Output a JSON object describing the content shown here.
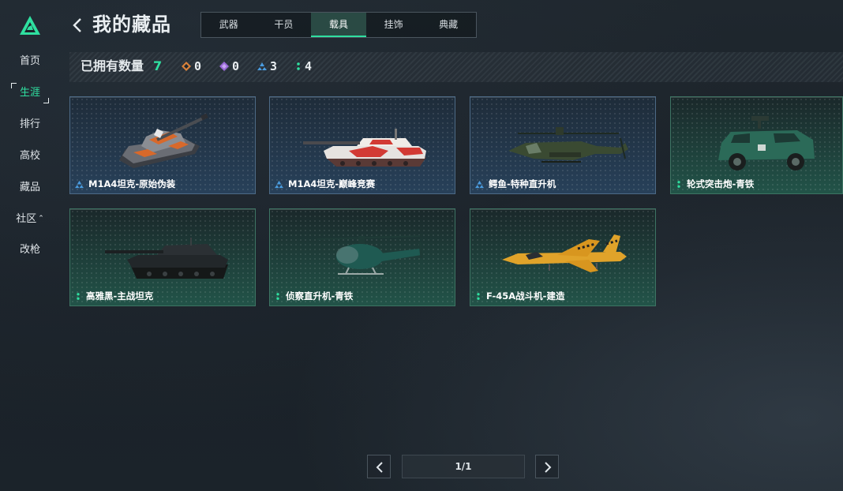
{
  "sidebar": {
    "items": [
      {
        "label": "首页",
        "active": false
      },
      {
        "label": "生涯",
        "active": true
      },
      {
        "label": "排行",
        "active": false
      },
      {
        "label": "高校",
        "active": false
      },
      {
        "label": "藏品",
        "active": false
      },
      {
        "label": "社区",
        "active": false,
        "has_chevron": true
      },
      {
        "label": "改枪",
        "active": false
      }
    ]
  },
  "header": {
    "title": "我的藏品",
    "tabs": [
      {
        "label": "武器",
        "active": false
      },
      {
        "label": "干员",
        "active": false
      },
      {
        "label": "载具",
        "active": true
      },
      {
        "label": "挂饰",
        "active": false
      },
      {
        "label": "典藏",
        "active": false
      }
    ]
  },
  "summary": {
    "owned_label": "已拥有数量",
    "owned_count": "7",
    "rarity_counts": [
      {
        "icon": "orange-diamond-rarity-icon",
        "color": "#d9823b",
        "count": "0"
      },
      {
        "icon": "purple-diamond-rarity-icon",
        "color": "#9b6ad8",
        "count": "0"
      },
      {
        "icon": "blue-triangle-rarity-icon",
        "color": "#4a9ce0",
        "count": "3"
      },
      {
        "icon": "green-dots-rarity-icon",
        "color": "#2fe0a0",
        "count": "4"
      }
    ]
  },
  "items": [
    {
      "name": "M1A4坦克-原始伪装",
      "rarity": "blue",
      "vehicle": "tank-orange-camo"
    },
    {
      "name": "M1A4坦克-巅峰竞赛",
      "rarity": "blue",
      "vehicle": "tank-red-white"
    },
    {
      "name": "鳄鱼-特种直升机",
      "rarity": "blue",
      "vehicle": "attack-helicopter"
    },
    {
      "name": "轮式突击炮-青铁",
      "rarity": "green",
      "vehicle": "armored-car"
    },
    {
      "name": "高雅黑-主战坦克",
      "rarity": "green",
      "vehicle": "tank-black"
    },
    {
      "name": "侦察直升机-青铁",
      "rarity": "green",
      "vehicle": "scout-helicopter"
    },
    {
      "name": "F-45A战斗机-建造",
      "rarity": "green",
      "vehicle": "jet-fighter-yellow"
    }
  ],
  "pager": {
    "page_text": "1/1"
  },
  "colors": {
    "accent": "#2fe0a0",
    "rare_blue": "#4a9ce0",
    "common_green": "#2fe0a0"
  }
}
